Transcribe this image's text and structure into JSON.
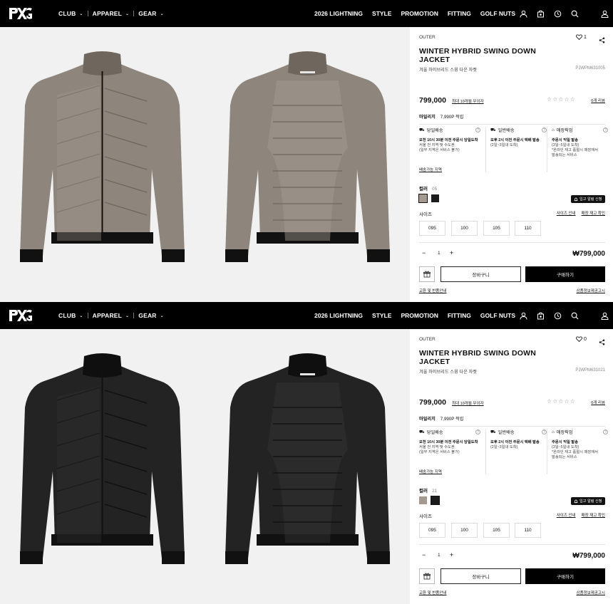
{
  "nav": {
    "left": [
      {
        "label": "CLUB"
      },
      {
        "label": "APPAREL"
      },
      {
        "label": "GEAR"
      }
    ],
    "right": [
      "2026 LIGHTNING",
      "STYLE",
      "PROMOTION",
      "FITTING",
      "GOLF NUTS"
    ]
  },
  "product": {
    "category": "OUTER",
    "title": "WINTER HYBRID SWING DOWN JACKET",
    "subtitle": "겨울 하이브리드 스윙 다운 자켓",
    "price": "799,000",
    "installment": "최대 10개월 무이자",
    "stars": "☆☆☆☆☆",
    "reviews": "0개 리뷰",
    "mileage_label": "마일리지",
    "mileage_value": "7,990P 적립",
    "shipping": [
      {
        "title": "당일배송",
        "bold": "오전 10시 30분 이전 주문시 당일도착",
        "lines": [
          "서울 전 지역 및 수도권",
          "(일부 지역은 서비스 불가)"
        ],
        "link": "배송가능 지역"
      },
      {
        "title": "일반배송",
        "bold": "오후 2시 이전 주문시 택배 발송",
        "lines": [
          "(2일~3일내 도착)"
        ],
        "link": ""
      },
      {
        "title": "매장픽업",
        "bold": "주문시 익일 발송",
        "lines": [
          "(3일~5일내 도착)",
          "*온라인 재고 품절시 매장에서",
          "발송되는 서비스"
        ],
        "link": ""
      }
    ],
    "color_label": "컬러",
    "restock_label": "입고 알림 신청",
    "size_label": "사이즈",
    "size_links": [
      "사이즈 안내",
      "매장 재고 확인"
    ],
    "sizes": [
      "095",
      "100",
      "105",
      "110"
    ],
    "qty_minus": "−",
    "qty": "1",
    "qty_plus": "+",
    "total": "₩799,000",
    "cart_label": "장바구니",
    "buy_label": "구매하기",
    "exchange_link": "교환 및 반품안내",
    "notice_link": "상품정보제공고시"
  },
  "panels": [
    {
      "like_count": "1",
      "code": "PJWPM631005",
      "color_code": "05",
      "swatches": [
        "#a59a8f",
        "#1b1b1b"
      ],
      "selected_swatch": 0,
      "jacket_color": "#8e857c",
      "jacket_shadow": "#6f665e",
      "jacket_light": "#a49c93"
    },
    {
      "like_count": "0",
      "code": "PJWPM631021",
      "color_code": "21",
      "swatches": [
        "#a59a8f",
        "#1b1b1b"
      ],
      "selected_swatch": 1,
      "jacket_color": "#232323",
      "jacket_shadow": "#0f0f0f",
      "jacket_light": "#353535"
    }
  ],
  "colors": {
    "nav_bg": "#000000",
    "gallery_bg": "#f1f1f1",
    "buy_bg": "#000000"
  }
}
